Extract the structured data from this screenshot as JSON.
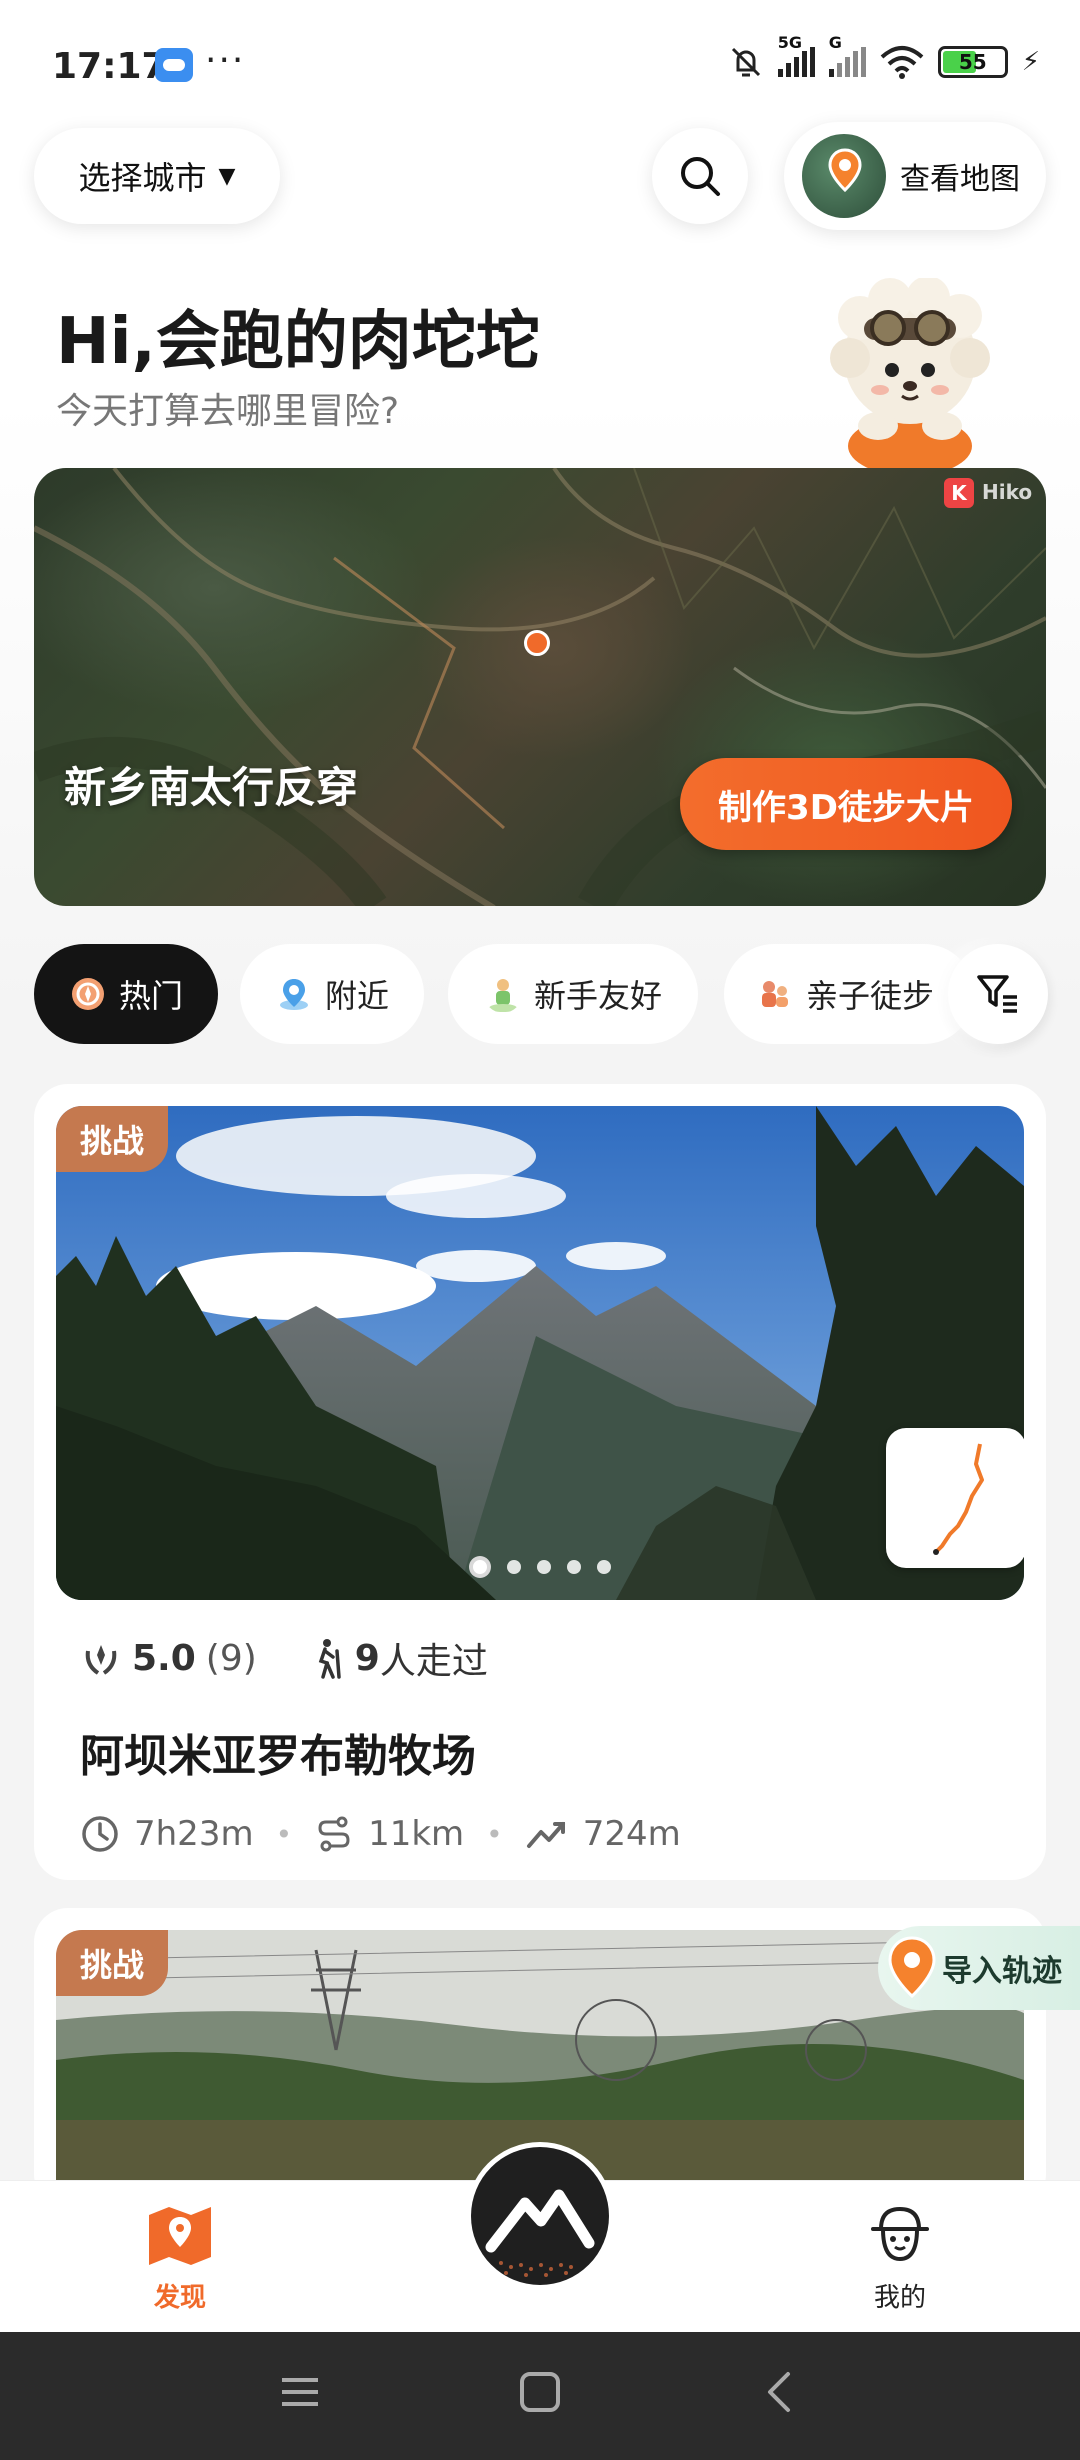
{
  "status_bar": {
    "time": "17:17",
    "battery": "55",
    "network_label": "5G",
    "g_label": "G"
  },
  "header": {
    "city_label": "选择城市",
    "map_label": "查看地图",
    "icons": [
      "search-icon",
      "map-pin-icon"
    ]
  },
  "greeting": {
    "title": "Hi,会跑的肉坨坨",
    "subtitle": "今天打算去哪里冒险?"
  },
  "hero": {
    "title": "新乡南太行反穿",
    "cta": "制作3D徒步大片",
    "brand": "Hiko",
    "badge": "K"
  },
  "chips": [
    {
      "label": "热门",
      "icon": "hot-icon",
      "active": true
    },
    {
      "label": "附近",
      "icon": "location-icon",
      "active": false
    },
    {
      "label": "新手友好",
      "icon": "beginner-icon",
      "active": false
    },
    {
      "label": "亲子徒步",
      "icon": "family-icon",
      "active": false
    }
  ],
  "cards": [
    {
      "tag": "挑战",
      "rating": "5.0",
      "rating_count": "(9)",
      "walked_count": "9",
      "walked_suffix": "人走过",
      "title": "阿坝米亚罗布勒牧场",
      "duration": "7h23m",
      "distance": "11km",
      "elevation": "724m",
      "image_count": 5,
      "active_image": 1
    },
    {
      "tag": "挑战"
    }
  ],
  "import_button": "导入轨迹",
  "bottom_nav": {
    "discover": "发现",
    "mine": "我的"
  },
  "colors": {
    "accent": "#f06a2a",
    "tag": "#c5794f",
    "active_chip": "#141414"
  }
}
